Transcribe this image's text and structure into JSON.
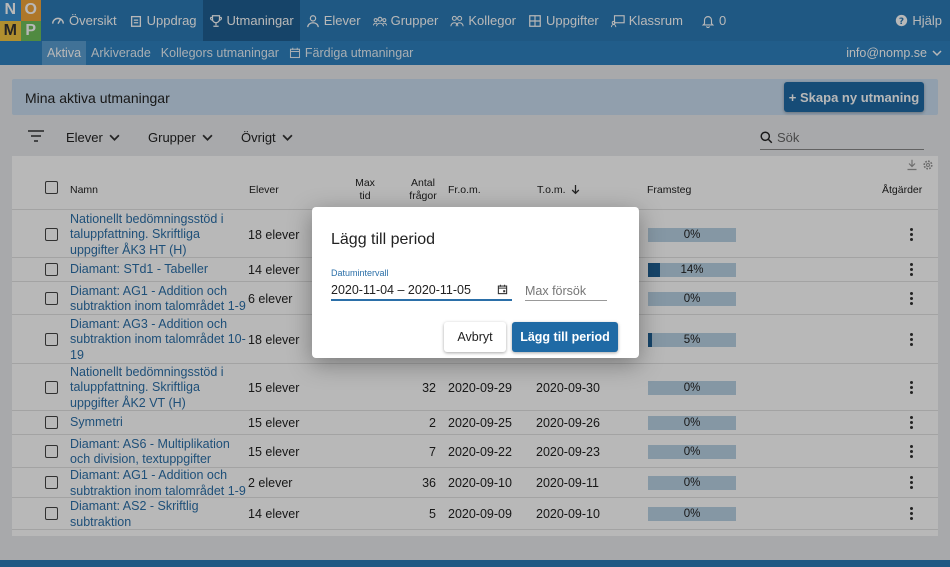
{
  "logo": {
    "letters": [
      "N",
      "O",
      "M",
      "P"
    ]
  },
  "nav": {
    "items": [
      {
        "label": "Översikt",
        "icon": "dashboard-icon"
      },
      {
        "label": "Uppdrag",
        "icon": "clipboard-icon"
      },
      {
        "label": "Utmaningar",
        "icon": "trophy-icon",
        "active": true
      },
      {
        "label": "Elever",
        "icon": "person-icon"
      },
      {
        "label": "Grupper",
        "icon": "group-icon"
      },
      {
        "label": "Kollegor",
        "icon": "people-icon"
      },
      {
        "label": "Uppgifter",
        "icon": "grid-icon"
      },
      {
        "label": "Klassrum",
        "icon": "classroom-icon"
      },
      {
        "label": "0",
        "icon": "bell-icon"
      }
    ],
    "help": "Hjälp"
  },
  "subnav": {
    "items": [
      {
        "label": "Aktiva",
        "active": true
      },
      {
        "label": "Arkiverade"
      },
      {
        "label": "Kollegors utmaningar"
      },
      {
        "label": "Färdiga utmaningar",
        "icon": "calendar-icon"
      }
    ],
    "account": "info@nomp.se"
  },
  "header": {
    "title": "Mina aktiva utmaningar",
    "create_label": "+ Skapa ny utmaning"
  },
  "filters": {
    "elever": "Elever",
    "grupper": "Grupper",
    "ovrigt": "Övrigt",
    "search_placeholder": "Sök"
  },
  "table": {
    "columns": {
      "name": "Namn",
      "elever": "Elever",
      "maxtid_1": "Max",
      "maxtid_2": "tid",
      "antal_1": "Antal",
      "antal_2": "frågor",
      "from": "Fr.o.m.",
      "tom": "T.o.m.",
      "framsteg": "Framsteg",
      "atgarder": "Åtgärder"
    },
    "rows": [
      {
        "name": "Nationellt bedömningsstöd i taluppfattning. Skriftliga uppgifter ÅK3 HT (H)",
        "elever": "18 elever",
        "antal": "",
        "from": "",
        "tom": "",
        "progress": 0,
        "progress_label": "0%"
      },
      {
        "name": "Diamant: STd1 - Tabeller",
        "elever": "14 elever",
        "antal": "",
        "from": "",
        "tom": "",
        "progress": 14,
        "progress_label": "14%"
      },
      {
        "name": "Diamant: AG1 - Addition och subtraktion inom talområdet 1-9",
        "elever": "6 elever",
        "antal": "",
        "from": "",
        "tom": "",
        "progress": 0,
        "progress_label": "0%"
      },
      {
        "name": "Diamant: AG3 - Addition och subtraktion inom talområdet 10-19",
        "elever": "18 elever",
        "antal": "",
        "from": "",
        "tom": "",
        "progress": 5,
        "progress_label": "5%"
      },
      {
        "name": "Nationellt bedömningsstöd i taluppfattning. Skriftliga uppgifter ÅK2 VT (H)",
        "elever": "15 elever",
        "antal": "32",
        "from": "2020-09-29",
        "tom": "2020-09-30",
        "progress": 0,
        "progress_label": "0%"
      },
      {
        "name": "Symmetri",
        "elever": "15 elever",
        "antal": "2",
        "from": "2020-09-25",
        "tom": "2020-09-26",
        "progress": 0,
        "progress_label": "0%"
      },
      {
        "name": "Diamant: AS6 - Multiplikation och division, textuppgifter",
        "elever": "15 elever",
        "antal": "7",
        "from": "2020-09-22",
        "tom": "2020-09-23",
        "progress": 0,
        "progress_label": "0%"
      },
      {
        "name": "Diamant: AG1 - Addition och subtraktion inom talområdet 1-9",
        "elever": "2 elever",
        "antal": "36",
        "from": "2020-09-10",
        "tom": "2020-09-11",
        "progress": 0,
        "progress_label": "0%"
      },
      {
        "name": "Diamant: AS2 - Skriftlig subtraktion",
        "elever": "14 elever",
        "antal": "5",
        "from": "2020-09-09",
        "tom": "2020-09-10",
        "progress": 0,
        "progress_label": "0%"
      }
    ]
  },
  "modal": {
    "title": "Lägg till period",
    "field_label": "Datumintervall",
    "date_value": "2020-11-04 – 2020-11-05",
    "tries_placeholder": "Max försök",
    "cancel_label": "Avbryt",
    "submit_label": "Lägg till period"
  },
  "colors": {
    "nav": "#2b7ab6",
    "accent": "#1f6aa5",
    "link": "#2b6fa8",
    "progress_bg": "#b9d1e4",
    "progress_fill": "#1f5f92"
  }
}
